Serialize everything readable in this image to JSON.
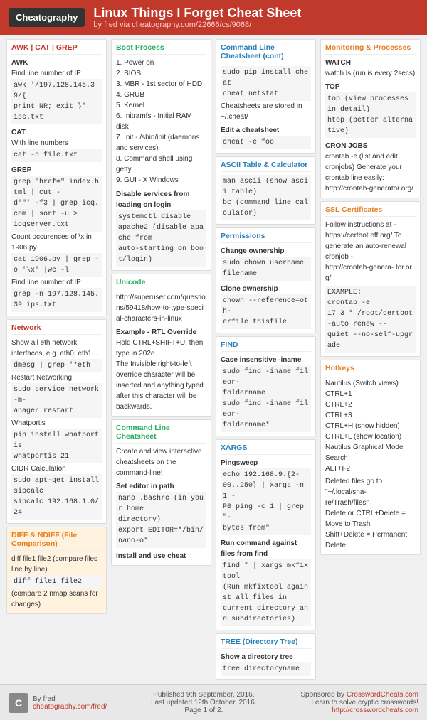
{
  "header": {
    "logo": "Cheatography",
    "title": "Linux Things I Forget Cheat Sheet",
    "by": "by fred via",
    "link_text": "cheatography.com/22666/cs/9068/",
    "link_url": "cheatography.com/22666/cs/9068/"
  },
  "col1": {
    "awk_cat_grep": {
      "title": "AWK | CAT | GREP",
      "awk_label": "AWK",
      "awk_item1": "Find line number of IP",
      "awk_code1": "awk '/197.128.145.39/{\nprint NR; exit }'\nips.txt",
      "cat_label": "CAT",
      "cat_item1": "With line numbers",
      "cat_code1": "cat -n file.txt",
      "grep_label": "GREP",
      "grep_item1": "grep \"href=\" index.html | cut -\nd'\"' -f3 | grep icq.com | sort -u >\nicqserver.txt",
      "grep_item2": "Count occurences of \\x in 1906.py",
      "grep_code2": "cat 1906.py | grep -o '\\x' |wc -l",
      "grep_item3": "Find line number of IP",
      "grep_code3": "grep -n 197.128.145.39 ips.txt"
    },
    "network": {
      "title": "Network",
      "item1": "Show all eth network interfaces, e.g. eth0, eth1...",
      "code1": "dmesg | grep '*eth",
      "item2": "Restart Networking",
      "code2": "sudo service network-m-\nanager restart",
      "item3": "Whatportis",
      "code3": "pip install whatportis\nwhatportis 21",
      "item4": "CIDR Calculation",
      "code4": "sudo apt-get install\nsipcalc\nsipcalc 192.168.1.0/24"
    },
    "diff": {
      "title": "DIFF & NDIFF (File Comparison)",
      "item1": "diff file1 file2 (compare files line by line)",
      "code1": "diff file1 file2",
      "item2": "(compare 2 nmap scans for changes)"
    }
  },
  "col2": {
    "boot": {
      "title": "Boot Process",
      "items": [
        "1. Power on",
        "2. BIOS",
        "3. MBR - 1st sector of HDD",
        "4. GRUB",
        "5. Kernel",
        "6. Initramfs - Initial RAM disk",
        "7. Init - /sbin/init (daemons and services)",
        "8. Command shell using getty",
        "9. GUI - X Windows"
      ],
      "disable_title": "Disable services from loading on login",
      "disable_code": "systemctl disable\napache2 (disable apache from\nauto-starting on boot/login)"
    },
    "unicode": {
      "title": "Unicode",
      "link": "http://superuser.com/questions/59418/how-to-type-special-characters-in-linux",
      "example_title": "Example - RTL Override",
      "example_text": "Hold CTRL+SHIFT+U, then type in 202e",
      "description": "The Invisible right-to-left override character will be inserted and anything typed after this character will be backwards."
    },
    "cmdline": {
      "title": "Command Line Cheatsheet",
      "desc": "Create and view interactive cheatsheets on the command-line!",
      "set_editor": "Set editor in path",
      "code1": "nano .bashrc (in your home\ndirectory)\nexport EDITOR=*/bin/nano-o*",
      "install": "Install and use cheat"
    }
  },
  "col3": {
    "cmdline_cont": {
      "title": "Command Line Cheatsheet (cont)",
      "code1": "sudo pip install cheat\ncheat netstat",
      "stored": "Cheatsheets are stored in ~/.cheat/",
      "edit_title": "Edit a cheatsheet",
      "edit_code": "cheat -e foo"
    },
    "ascii": {
      "title": "ASCII Table & Calculator",
      "code1": "man ascii (show ascii table)\nbc (command line calculator)"
    },
    "permissions": {
      "title": "Permissions",
      "change_title": "Change ownership",
      "change_code": "sudo chown username\nfilename",
      "clone_title": "Clone ownership",
      "clone_code": "chown --reference=oth-\nerfile thisfile"
    },
    "find": {
      "title": "FIND",
      "case_title": "Case insensitive -iname",
      "case_code": "sudo find -iname fileor-\nfoldername\nsudo find -iname fileor-\nfoldername*"
    },
    "xargs": {
      "title": "XARGS",
      "pingsweep_title": "Pingsweep",
      "pingsweep_code": "echo 192.168.9.{2-\n00..250} | xargs -n 1 -\nP0 ping -c 1 | grep \"-\nbytes from\"",
      "run_title": "Run command against files from find",
      "run_code": "find * | xargs mkfixtool\n(Run mkfixtool against all files in\ncurrent directory and subdirectories)"
    },
    "tree": {
      "title": "TREE (Directory Tree)",
      "show_title": "Show a directory tree",
      "show_code": "tree directoryname"
    }
  },
  "col4": {
    "monitoring": {
      "title": "Monitoring & Processes",
      "watch_title": "WATCH",
      "watch_desc": "watch ls (run is every 2secs)",
      "top_title": "TOP",
      "top_desc": "top (view processes in detail)\nhtop (better alternative)",
      "cron_title": "CRON JOBS",
      "cron_desc": "crontab -e (list and edit cronjobs)\nGenerate your crontab line easily:",
      "cron_link": "http://crontab-generator.org/"
    },
    "ssl": {
      "title": "SSL Certificates",
      "desc": "Follow instructions at -\nhttps://certbot.eff.org/\nTo generate an auto-renewal\ncronjob -",
      "link1": "http://crontab-genera-\ntor.org/",
      "example": "EXAMPLE:\ncrontab -e\n17 3 * /root/certbot-auto renew --\nquiet --no-self-upgrade"
    },
    "hotkeys": {
      "title": "Hotkeys",
      "items": [
        "Nautilus (Switch views)",
        "CTRL+1",
        "CTRL+2",
        "CTRL+3",
        "CTRL+H (show hidden)",
        "CTRL+L (show location)",
        "Nautilus Graphical Mode Search",
        "ALT+F2",
        "Deleted files go to \"~/.local/share/Trash/files\"",
        "Delete or CTRL+Delete = Move to Trash",
        "Shift+Delete = Permanent Delete"
      ]
    }
  },
  "footer": {
    "logo_letter": "C",
    "author": "By fred",
    "author_link": "cheatography.com/fred/",
    "published": "Published 9th September, 2016.",
    "updated": "Last updated 12th October, 2016.",
    "page": "Page 1 of 2.",
    "sponsor": "Sponsored by",
    "sponsor_name": "CrosswordCheats.com",
    "sponsor_desc": "Learn to solve cryptic crosswords!",
    "sponsor_link": "http://crosswordcheats.com"
  }
}
